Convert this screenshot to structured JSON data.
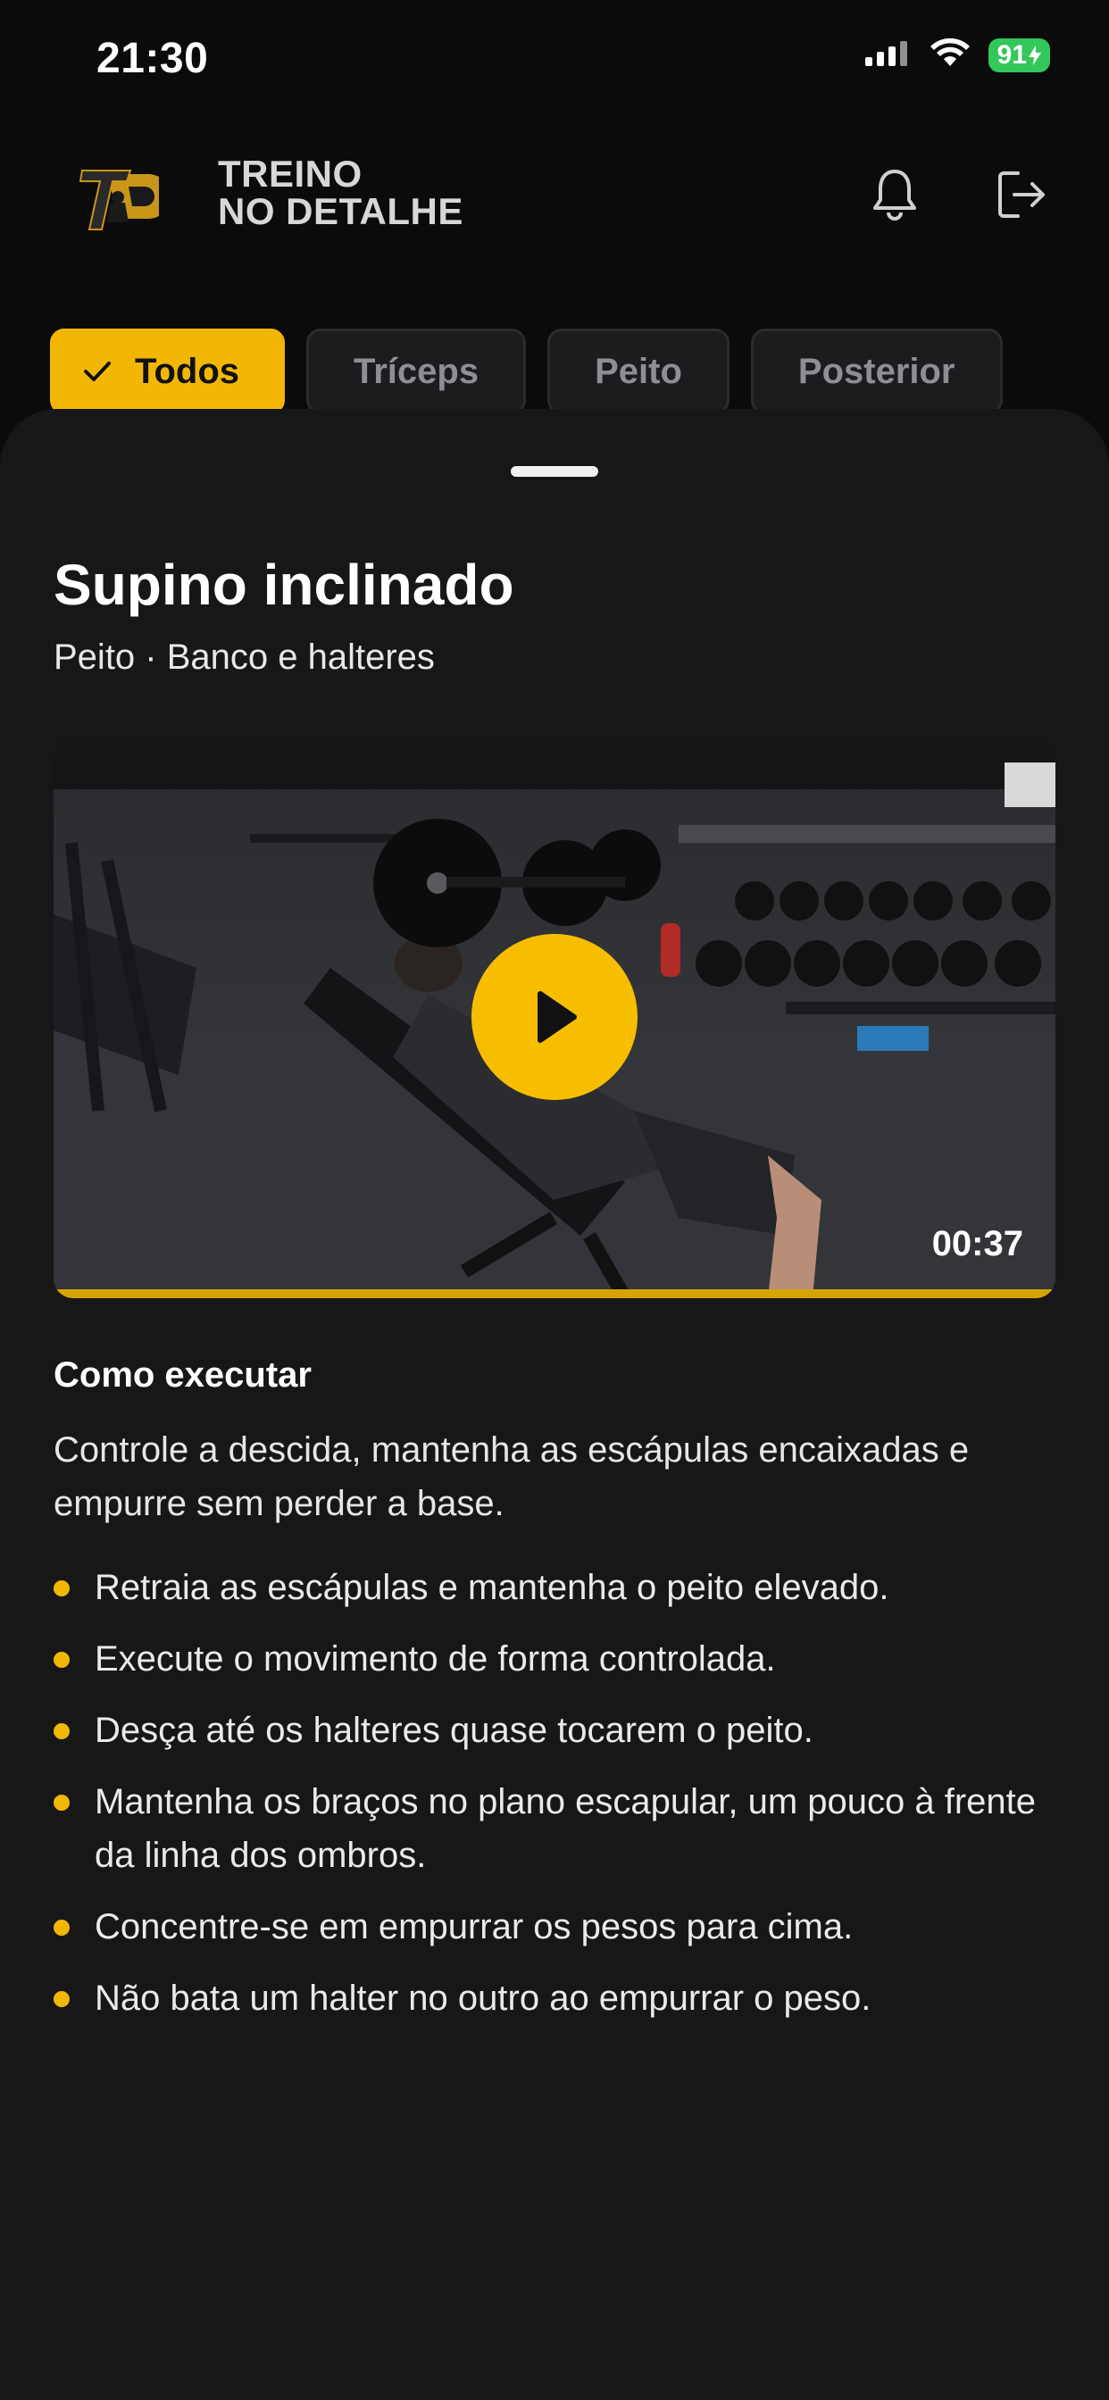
{
  "status_bar": {
    "time": "21:30",
    "battery": "91"
  },
  "header": {
    "logo_icon": "td-logo-icon",
    "brand_line1": "TREINO",
    "brand_line2": "NO DETALHE",
    "bell_icon": "bell-icon",
    "logout_icon": "logout-icon"
  },
  "chips": [
    {
      "label": "Todos",
      "active": true
    },
    {
      "label": "Tríceps",
      "active": false
    },
    {
      "label": "Peito",
      "active": false
    },
    {
      "label": "Posterior",
      "active": false
    }
  ],
  "exercise": {
    "title": "Supino inclinado",
    "subtitle": "Peito · Banco e halteres",
    "video": {
      "duration": "00:37",
      "progress": 1.0
    },
    "section_title": "Como executar",
    "description": "Controle a descida, mantenha as escápulas encaixadas e empurre sem perder a base.",
    "steps": [
      "Retraia as escápulas e mantenha o peito elevado.",
      "Execute o movimento de forma controlada.",
      "Desça até os halteres quase tocarem o peito.",
      "Mantenha os braços no plano escapular, um pouco à frente da linha dos ombros.",
      "Concentre-se em empurrar os pesos para cima.",
      "Não bata um halter no outro ao empurrar o peso."
    ]
  },
  "colors": {
    "accent": "#f2b705",
    "background": "#0b0b0c",
    "sheet": "#171718"
  }
}
